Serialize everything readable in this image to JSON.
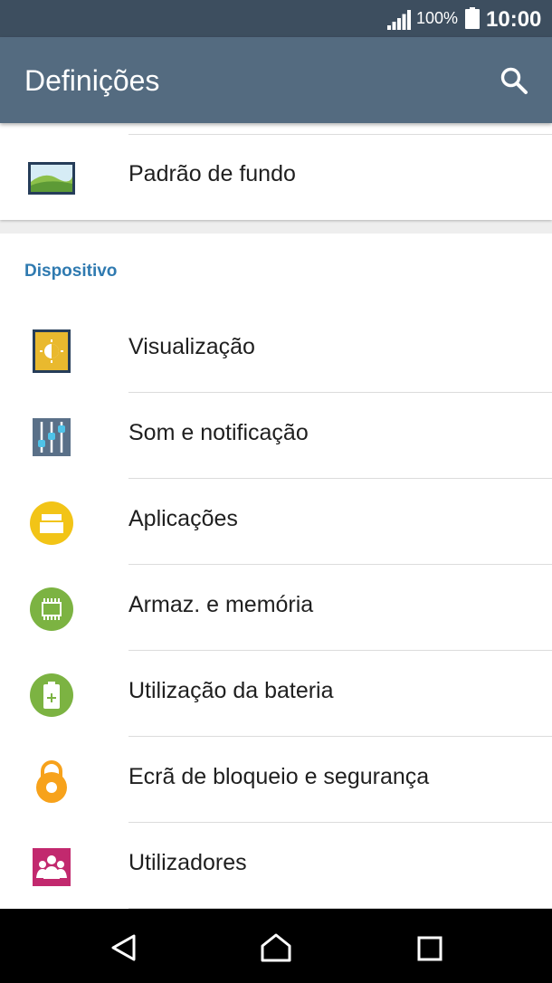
{
  "status_bar": {
    "battery_percent": "100%",
    "time": "10:00"
  },
  "app_bar": {
    "title": "Definições"
  },
  "wallpaper_item": {
    "label": "Padrão de fundo"
  },
  "device_section": {
    "header": "Dispositivo",
    "items": [
      {
        "label": "Visualização",
        "icon": "display-icon"
      },
      {
        "label": "Som e notificação",
        "icon": "sound-sliders-icon"
      },
      {
        "label": "Aplicações",
        "icon": "apps-icon"
      },
      {
        "label": "Armaz. e memória",
        "icon": "storage-chip-icon"
      },
      {
        "label": "Utilização da bateria",
        "icon": "battery-icon"
      },
      {
        "label": "Ecrã de bloqueio e segurança",
        "icon": "lock-icon"
      },
      {
        "label": "Utilizadores",
        "icon": "users-icon"
      }
    ]
  },
  "colors": {
    "status_bar": "#3d4e5f",
    "app_bar": "#546b80",
    "section_header": "#2f7ab0"
  }
}
